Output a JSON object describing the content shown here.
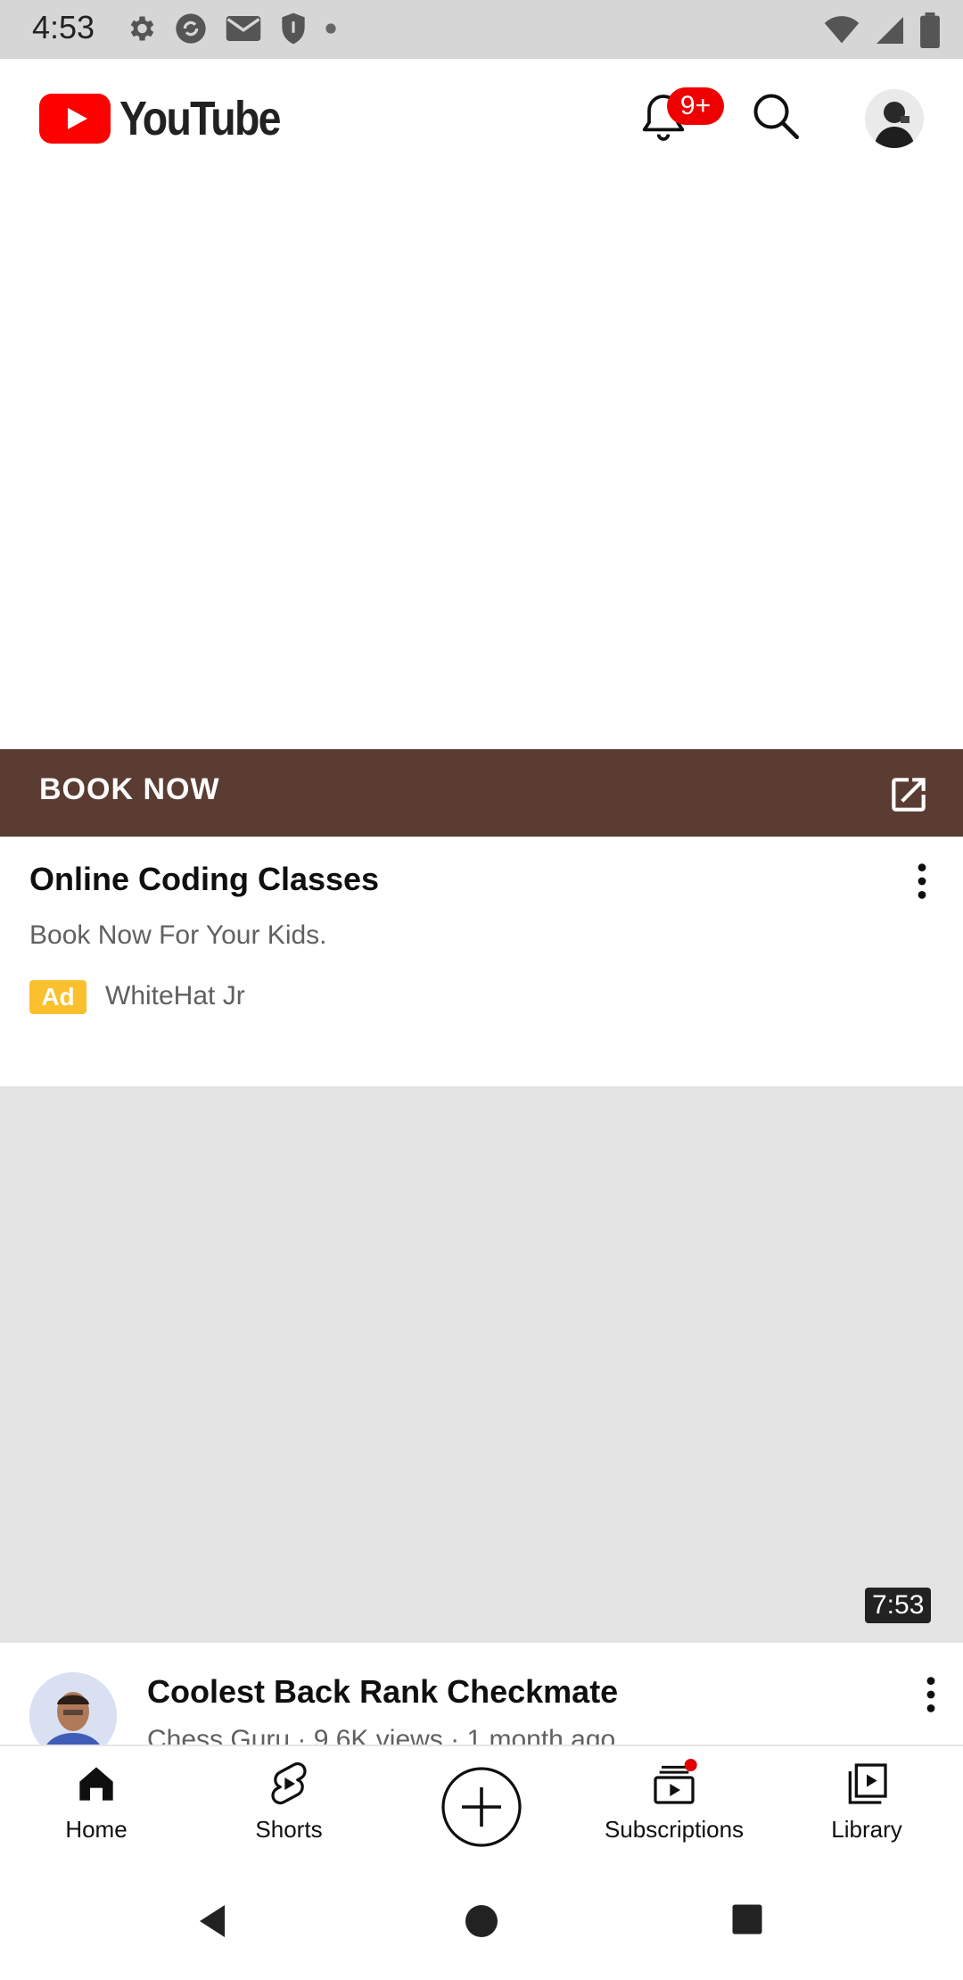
{
  "status_bar": {
    "time": "4:53"
  },
  "app_bar": {
    "brand": "YouTube",
    "notification_badge": "9+"
  },
  "ad": {
    "cta_label": "BOOK NOW",
    "title": "Online Coding Classes",
    "subtitle": "Book Now For Your Kids.",
    "badge": "Ad",
    "advertiser": "WhiteHat Jr"
  },
  "video": {
    "duration": "7:53",
    "title": "Coolest Back Rank Checkmate",
    "meta": "Chess Guru · 9.6K views · 1 month ago"
  },
  "bottom_nav": {
    "items": [
      {
        "label": "Home"
      },
      {
        "label": "Shorts"
      },
      {
        "label": "Subscriptions"
      },
      {
        "label": "Library"
      }
    ]
  },
  "colors": {
    "brand_red": "#ff0000",
    "cta_brown": "#5a3c32",
    "ad_yellow": "#fbc02d",
    "badge_red": "#e00000"
  }
}
